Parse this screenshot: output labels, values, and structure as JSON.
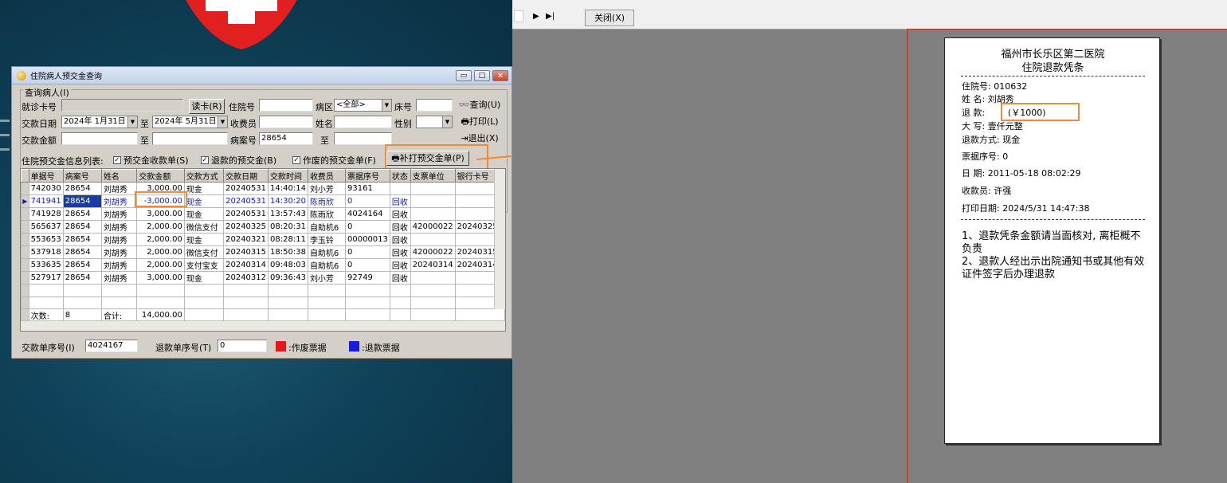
{
  "window": {
    "title": "住院病人预交金查询"
  },
  "query_group": {
    "legend": "查询病人(I)"
  },
  "form": {
    "card_label": "就诊卡号",
    "card_value": "",
    "read_card_btn": "读卡(R)",
    "admission_no_label": "住院号",
    "admission_no_value": "",
    "ward_label": "病区",
    "ward_value": "<全部>",
    "bed_label": "床号",
    "bed_value": "",
    "query_btn": "查询(U)",
    "pay_date_label": "交款日期",
    "pay_date_from": "2024年 1月31日",
    "to1": "至",
    "pay_date_to": "2024年 5月31日",
    "cashier_label": "收费员",
    "cashier_value": "",
    "name_label": "姓名",
    "name_value": "",
    "gender_label": "性别",
    "gender_value": "",
    "print_btn": "打印(L)",
    "amount_label": "交款金额",
    "amount_from": "",
    "to2": "至",
    "amount_to": "",
    "case_no_label": "病案号",
    "case_no_value": "28654",
    "to3": "至",
    "case_no_to": "",
    "exit_btn": "退出(X)"
  },
  "filters": {
    "list_label": "住院预交金信息列表:",
    "receipt_chk": "预交金收款单(S)",
    "refund_chk": "退款的预交金(B)",
    "void_chk": "作废的预交金单(F)",
    "reprint_btn": "补打预交金单(P)"
  },
  "grid": {
    "columns": [
      "单据号",
      "病案号",
      "姓名",
      "交款金额",
      "交款方式",
      "交款日期",
      "交款时间",
      "收费员",
      "票据序号",
      "状态",
      "支票单位",
      "银行卡号"
    ],
    "rows": [
      [
        "742030",
        "28654",
        "刘胡秀",
        "3,000.00",
        "现金",
        "20240531",
        "14:40:14",
        "刘小芳",
        "93161",
        "",
        "",
        ""
      ],
      [
        "741941",
        "28654",
        "刘胡秀",
        "-3,000.00",
        "现金",
        "20240531",
        "14:30:20",
        "陈雨欣",
        "0",
        "回收",
        "",
        ""
      ],
      [
        "741928",
        "28654",
        "刘胡秀",
        "3,000.00",
        "现金",
        "20240531",
        "13:57:43",
        "陈雨欣",
        "4024164",
        "回收",
        "",
        ""
      ],
      [
        "565637",
        "28654",
        "刘胡秀",
        "2,000.00",
        "微信支付",
        "20240325",
        "08:20:31",
        "自助机6",
        "0",
        "回收",
        "42000022",
        "202403250"
      ],
      [
        "553653",
        "28654",
        "刘胡秀",
        "2,000.00",
        "现金",
        "20240321",
        "08:28:11",
        "李玉铃",
        "00000013",
        "回收",
        "",
        ""
      ],
      [
        "537918",
        "28654",
        "刘胡秀",
        "2,000.00",
        "微信支付",
        "20240315",
        "18:50:38",
        "自助机6",
        "0",
        "回收",
        "42000022",
        "202403151"
      ],
      [
        "533635",
        "28654",
        "刘胡秀",
        "2,000.00",
        "支付宝支",
        "20240314",
        "09:48:03",
        "自助机6",
        "0",
        "回收",
        "20240314",
        "202403140"
      ],
      [
        "527917",
        "28654",
        "刘胡秀",
        "3,000.00",
        "现金",
        "20240312",
        "09:36:43",
        "刘小芳",
        "92749",
        "回收",
        "",
        ""
      ]
    ],
    "footer_count_label": "次数:",
    "footer_count": "8",
    "footer_sum_label": "合计:",
    "footer_sum": "14,000.00"
  },
  "bottom": {
    "pay_seq_label": "交款单序号(I)",
    "pay_seq_value": "4024167",
    "refund_seq_label": "退款单序号(T)",
    "refund_seq_value": "0",
    "void_legend": ":作废票据",
    "refund_legend": ":退款票据",
    "void_color": "#e11b1b",
    "refund_color": "#1a1ae0"
  },
  "preview_toolbar": {
    "nav_next": "▶",
    "nav_last": "▶|",
    "close_btn": "关闭(X)"
  },
  "receipt": {
    "hospital": "福州市长乐区第二医院",
    "title": "住院退款凭条",
    "admission_no": "住院号: 010632",
    "name": "姓  名: 刘胡秀",
    "refund_label": "退  款:",
    "refund_amount": "(￥1000)",
    "capital": "大  写:  壹仟元整",
    "method": "退款方式: 现金",
    "ticket_seq": "票据序号: 0",
    "date": "日  期: 2011-05-18 08:02:29",
    "cashier": "收款员: 许强",
    "print_date": "打印日期: 2024/5/31  14:47:38",
    "note1": "1、退款凭条金额请当面核对, 离柜概不负责",
    "note2": "2、退款人经出示出院通知书或其他有效证件签字后办理退款"
  },
  "colors": {
    "highlight": "#ef8a3a",
    "page_border": "#d83a2a",
    "selected_cell": "#1a3aa6"
  }
}
